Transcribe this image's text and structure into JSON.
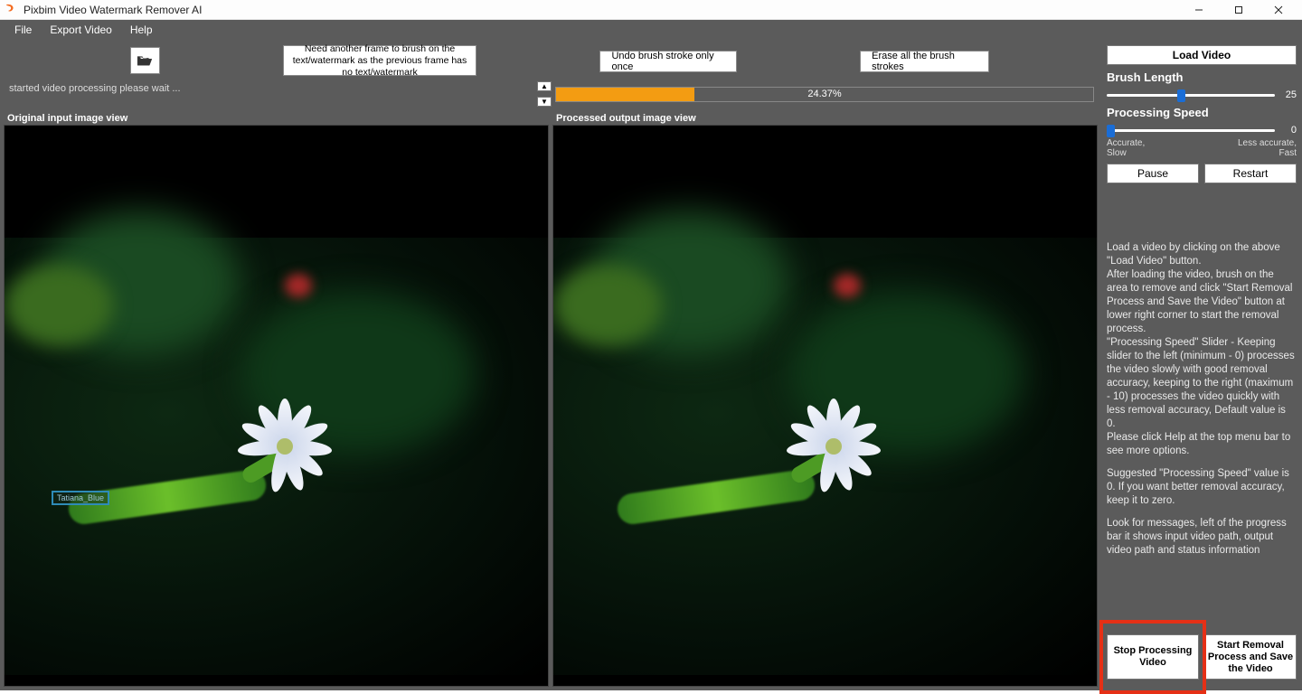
{
  "titlebar": {
    "title": "Pixbim Video Watermark Remover AI"
  },
  "menu": {
    "file": "File",
    "export": "Export Video",
    "help": "Help"
  },
  "toolbar": {
    "need_frame": "Need another frame to brush on the text/watermark as the previous frame has no text/watermark",
    "undo": "Undo brush stroke only once",
    "erase": "Erase all the brush strokes"
  },
  "status_log": "started video processing please wait ...",
  "progress": {
    "text": "24.37%",
    "percent": 24.37
  },
  "views": {
    "input_title": "Original input image view",
    "output_title": "Processed output image view",
    "watermark_text": "Tatiana_Blue"
  },
  "panel": {
    "load": "Load Video",
    "brush_label": "Brush Length",
    "brush_value": "25",
    "speed_label": "Processing Speed",
    "speed_value": "0",
    "speed_left": "Accurate,\nSlow",
    "speed_right": "Less accurate,\nFast",
    "pause": "Pause",
    "restart": "Restart",
    "instructions_p1": "Load a video by clicking on the above \"Load Video\" button.\nAfter loading the video, brush on the area to remove and click \"Start Removal Process and Save the Video\" button at lower right corner to start the removal process.\n\"Processing Speed\" Slider - Keeping slider to the left (minimum - 0) processes the video slowly with good removal accuracy, keeping to the right (maximum - 10) processes the video quickly with less removal accuracy, Default value is 0.\nPlease click Help at the top menu bar to see more options.",
    "instructions_p2": "Suggested \"Processing Speed\" value is 0. If you want better removal accuracy, keep it to zero.",
    "instructions_p3": "Look for messages, left of the progress bar it shows input video path, output video path and status information",
    "stop": "Stop Processing Video",
    "start": "Start Removal Process and Save the Video"
  }
}
